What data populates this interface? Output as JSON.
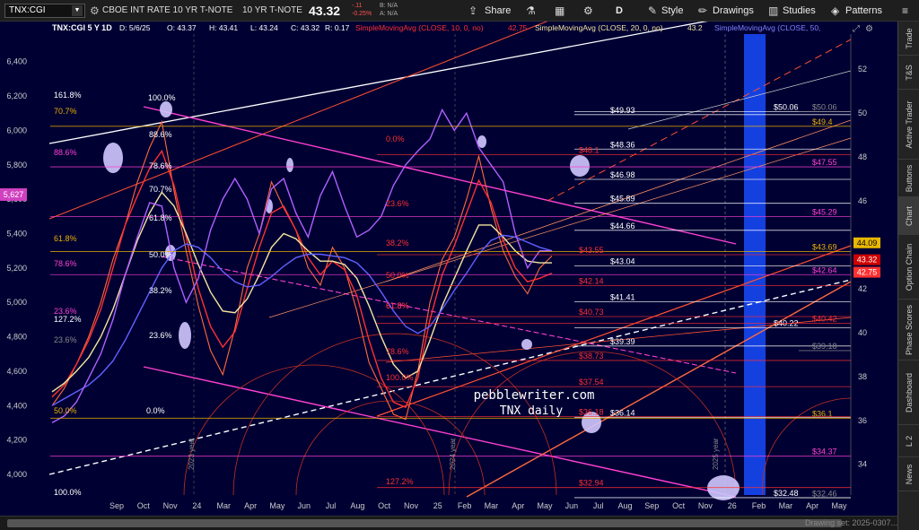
{
  "toolbar": {
    "symbol": "TNX:CGI",
    "description": "CBOE INT RATE 10 YR T-NOTE",
    "short_description": "10 YR T-NOTE",
    "last_price": "43.32",
    "change": "-.11",
    "change_pct": "-0.25%",
    "bid": "B: N/A",
    "ask": "A: N/A",
    "share_label": "Share",
    "period_label": "D",
    "style_label": "Style",
    "drawings_label": "Drawings",
    "studies_label": "Studies",
    "patterns_label": "Patterns",
    "icons": [
      "share-icon",
      "flask-icon",
      "grid-icon",
      "gear-icon",
      "pencil-icon",
      "chart-icon",
      "patterns-icon",
      "menu-icon"
    ]
  },
  "header": {
    "title": "TNX:CGI 5 Y 1D",
    "date": "D: 5/6/25",
    "open": "O: 43.37",
    "high": "H: 43.41",
    "low": "L: 43.24",
    "close": "C: 43.32",
    "r": "R: 0.17",
    "sma10": "SimpleMovingAvg (CLOSE, 10, 0, no)",
    "sma10_value": "42.75",
    "sma20": "SimpleMovingAvg (CLOSE, 20, 0, no)",
    "sma20_value": "43.2",
    "sma50": "SimpleMovingAvg (CLOSE, 50,"
  },
  "colors": {
    "background": "#000033",
    "price": "#ff6a3d",
    "sma10": "#ff3030",
    "sma20": "#f5e6a0",
    "sma50": "#6060ff",
    "purple": "#b060ff",
    "magenta": "#ff40d0",
    "gold": "#e8b000",
    "blue_band": "#1540e0",
    "orange_line": "#ff7040"
  },
  "sidepanel": {
    "tabs": [
      "Trade",
      "T&S",
      "Active Trader",
      "Buttons",
      "Chart",
      "Option Chain",
      "Phase Scores",
      "Dashboard",
      "L 2",
      "News"
    ],
    "active": "Chart"
  },
  "footer": {
    "drawing_set": "Drawing set: 2025-0307..."
  },
  "chart_data": {
    "type": "line",
    "title": "TNX:CGI 5 Y 1D",
    "watermark": [
      "pebblewriter.com",
      "TNX daily"
    ],
    "left_axis": {
      "ylim": [
        3880,
        6560
      ],
      "ticks": [
        "6,400",
        "6,200",
        "6,000",
        "5,800",
        "5,600",
        "5,400",
        "5,200",
        "5,000",
        "4,800",
        "4,600",
        "4,400",
        "4,200",
        "4,000"
      ],
      "marker": "5,627"
    },
    "right_axis": {
      "ylim": [
        32.6,
        53.6
      ],
      "ticks": [
        "52",
        "50",
        "48",
        "46",
        "44",
        "42",
        "40",
        "38",
        "36",
        "34"
      ]
    },
    "x_ticks": [
      "Sep",
      "Oct",
      "Nov",
      "24",
      "Mar",
      "Apr",
      "May",
      "Jun",
      "Jul",
      "Aug",
      "Oct",
      "Nov",
      "25",
      "Feb",
      "Mar",
      "Apr",
      "May",
      "Jun",
      "Jul",
      "Aug",
      "Sep",
      "Oct",
      "Nov",
      "26",
      "Feb",
      "Mar",
      "Apr",
      "May"
    ],
    "year_markers": [
      "2023 year",
      "2024 year",
      "2025 year"
    ],
    "price_badges": [
      {
        "label": "44.09",
        "y": 44.09,
        "bg": "#e8b800",
        "fg": "#000000"
      },
      {
        "label": "43.32",
        "y": 43.32,
        "bg": "#d00000",
        "fg": "#ffffff"
      },
      {
        "label": "42.75",
        "y": 42.75,
        "bg": "#ff3030",
        "fg": "#ffffff"
      }
    ],
    "horizontal_levels": [
      {
        "y": 49.93,
        "label": "$49.93",
        "color": "#ffffff"
      },
      {
        "y": 48.36,
        "label": "$48.36",
        "color": "#ffffff"
      },
      {
        "y": 46.98,
        "label": "$46.98",
        "color": "#ffffff"
      },
      {
        "y": 45.89,
        "label": "$45.89",
        "color": "#ffffff"
      },
      {
        "y": 44.66,
        "label": "$44.66",
        "color": "#ffffff"
      },
      {
        "y": 43.04,
        "label": "$43.04",
        "color": "#ffffff"
      },
      {
        "y": 41.41,
        "label": "$41.41",
        "color": "#ffffff"
      },
      {
        "y": 39.39,
        "label": "$39.39",
        "color": "#ffffff"
      },
      {
        "y": 36.14,
        "label": "$36.14",
        "color": "#ffffff"
      },
      {
        "y": 50.06,
        "label": "$50.06",
        "color": "#ffffff"
      },
      {
        "y": 40.22,
        "label": "$40.22",
        "color": "#ffffff"
      },
      {
        "y": 32.48,
        "label": "$32.48",
        "color": "#ffffff"
      },
      {
        "y": 49.4,
        "label": "$49.4",
        "color": "#e8b000"
      },
      {
        "y": 47.55,
        "label": "$47.55",
        "color": "#ff40d0"
      },
      {
        "y": 43.69,
        "label": "$43.69",
        "color": "#e8b000"
      },
      {
        "y": 42.64,
        "label": "$42.64",
        "color": "#ff40d0"
      },
      {
        "y": 40.42,
        "label": "$40.42",
        "color": "#ff3030"
      },
      {
        "y": 36.1,
        "label": "$36.1",
        "color": "#e8b000"
      },
      {
        "y": 34.37,
        "label": "$34.37",
        "color": "#ff40d0"
      },
      {
        "y": 48.1,
        "label": "$48.1",
        "color": "#ff3030"
      },
      {
        "y": 45.29,
        "label": "$45.29",
        "color": "#ff40d0"
      },
      {
        "y": 43.55,
        "label": "$43.55",
        "color": "#ff3030"
      },
      {
        "y": 42.14,
        "label": "$42.14",
        "color": "#ff3030"
      },
      {
        "y": 40.73,
        "label": "$40.73",
        "color": "#ff3030"
      },
      {
        "y": 38.73,
        "label": "$38.73",
        "color": "#ff3030"
      },
      {
        "y": 37.54,
        "label": "$37.54",
        "color": "#ff3030"
      },
      {
        "y": 36.18,
        "label": "$36.18",
        "color": "#ff3030"
      },
      {
        "y": 32.94,
        "label": "$32.94",
        "color": "#ff3030"
      },
      {
        "y": 50.06,
        "label": "$50.06",
        "color": "#888888"
      },
      {
        "y": 39.18,
        "label": "$39.18",
        "color": "#888888"
      },
      {
        "y": 32.46,
        "label": "$32.46",
        "color": "#888888"
      }
    ],
    "fib_labels": [
      {
        "label": "161.8%",
        "color": "#ffffff"
      },
      {
        "label": "100.0%",
        "color": "#ffffff"
      },
      {
        "label": "70.7%",
        "color": "#e8b000"
      },
      {
        "label": "88.6%",
        "color": "#ff40d0"
      },
      {
        "label": "88.6%",
        "color": "#ffffff"
      },
      {
        "label": "78.6%",
        "color": "#ffffff"
      },
      {
        "label": "70.7%",
        "color": "#ffffff"
      },
      {
        "label": "61.8%",
        "color": "#ffffff"
      },
      {
        "label": "61.8%",
        "color": "#e8b000"
      },
      {
        "label": "50.0%",
        "color": "#ffffff"
      },
      {
        "label": "78.6%",
        "color": "#ff40d0"
      },
      {
        "label": "38.2%",
        "color": "#ffffff"
      },
      {
        "label": "23.6%",
        "color": "#ff40d0"
      },
      {
        "label": "127.2%",
        "color": "#ffffff"
      },
      {
        "label": "23.6%",
        "color": "#888888"
      },
      {
        "label": "23.6%",
        "color": "#ffffff"
      },
      {
        "label": "50.0%",
        "color": "#e8b000"
      },
      {
        "label": "0.0%",
        "color": "#ffffff"
      },
      {
        "label": "61.8%",
        "color": "#ff40d0"
      },
      {
        "label": "100.0%",
        "color": "#ffffff"
      },
      {
        "label": "0.0%",
        "color": "#ff3030"
      },
      {
        "label": "23.6%",
        "color": "#ff3030"
      },
      {
        "label": "38.2%",
        "color": "#ff3030"
      },
      {
        "label": "50.0%",
        "color": "#ff3030"
      },
      {
        "label": "61.8%",
        "color": "#ff3030"
      },
      {
        "label": "78.6%",
        "color": "#ff3030"
      },
      {
        "label": "100.0%",
        "color": "#ff3030"
      },
      {
        "label": "127.2%",
        "color": "#ff3030"
      }
    ],
    "series": [
      {
        "color": "#ff6a3d",
        "values": [
          4400,
          4500,
          4640,
          4800,
          5000,
          5250,
          5450,
          5700,
          5900,
          6050,
          5650,
          5300,
          4980,
          4720,
          4580,
          4850,
          5200,
          5400,
          5700,
          5550,
          5420,
          5200,
          5100,
          5320,
          5200,
          4950,
          4650,
          4500,
          4350,
          4320,
          4600,
          5000,
          5250,
          5380,
          5600,
          5850,
          5550,
          5300,
          5150,
          5050,
          5200,
          5270
        ]
      },
      {
        "color": "#ff3030",
        "values": [
          4450,
          4520,
          4640,
          4780,
          4960,
          5200,
          5450,
          5620,
          5780,
          5880,
          5680,
          5380,
          5080,
          4860,
          4740,
          4830,
          5080,
          5320,
          5520,
          5560,
          5420,
          5260,
          5160,
          5240,
          5190,
          5040,
          4780,
          4560,
          4420,
          4390,
          4560,
          4900,
          5160,
          5330,
          5520,
          5710,
          5580,
          5360,
          5200,
          5120,
          5140,
          5170
        ]
      },
      {
        "color": "#f5e6a0",
        "values": [
          4480,
          4530,
          4600,
          4680,
          4800,
          4960,
          5160,
          5360,
          5520,
          5640,
          5560,
          5400,
          5220,
          5060,
          4950,
          4940,
          5020,
          5160,
          5320,
          5400,
          5370,
          5300,
          5240,
          5240,
          5220,
          5140,
          4980,
          4800,
          4640,
          4560,
          4600,
          4780,
          4980,
          5140,
          5300,
          5450,
          5450,
          5380,
          5300,
          5240,
          5230,
          5230
        ]
      },
      {
        "color": "#6060ff",
        "values": [
          4400,
          4440,
          4480,
          4520,
          4580,
          4660,
          4780,
          4920,
          5060,
          5200,
          5300,
          5340,
          5320,
          5260,
          5180,
          5120,
          5090,
          5100,
          5150,
          5210,
          5260,
          5280,
          5280,
          5270,
          5260,
          5230,
          5160,
          5060,
          4950,
          4860,
          4820,
          4860,
          4960,
          5070,
          5170,
          5280,
          5360,
          5390,
          5380,
          5350,
          5320,
          5300
        ]
      },
      {
        "color": "#b060ff",
        "values": [
          4300,
          4340,
          4420,
          4560,
          4700,
          4900,
          5160,
          5380,
          5580,
          5560,
          5200,
          5000,
          5140,
          5420,
          5600,
          5720,
          5600,
          5400,
          5660,
          5720,
          5520,
          5380,
          5620,
          5760,
          5560,
          5380,
          5420,
          5500,
          5680,
          5800,
          5880,
          5950,
          6120,
          6000,
          6100,
          5900,
          5800,
          5700,
          5400,
          5200,
          5300,
          5300
        ]
      }
    ]
  }
}
